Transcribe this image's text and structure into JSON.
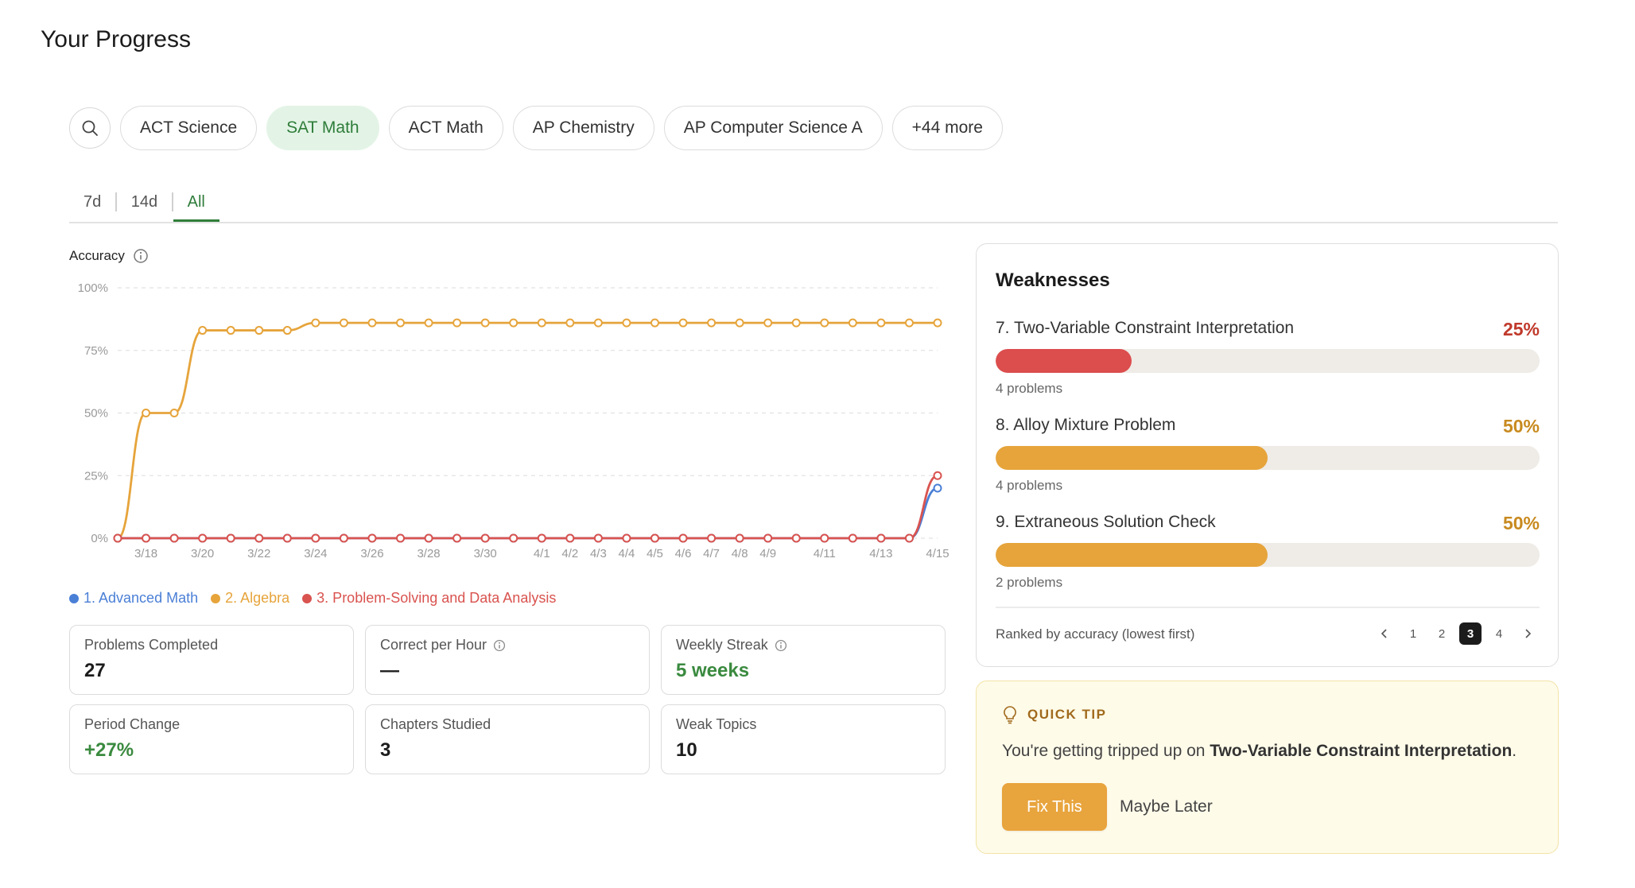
{
  "page": {
    "title": "Your Progress"
  },
  "subjects": {
    "items": [
      {
        "label": "ACT Science",
        "active": false
      },
      {
        "label": "SAT Math",
        "active": true
      },
      {
        "label": "ACT Math",
        "active": false
      },
      {
        "label": "AP Chemistry",
        "active": false
      },
      {
        "label": "AP Computer Science A",
        "active": false
      },
      {
        "label": "+44 more",
        "active": false
      }
    ]
  },
  "range_tabs": [
    {
      "label": "7d",
      "active": false
    },
    {
      "label": "14d",
      "active": false
    },
    {
      "label": "All",
      "active": true
    }
  ],
  "accuracy": {
    "label": "Accuracy"
  },
  "chart_data": {
    "type": "line",
    "ylabel": "Accuracy",
    "ylim": [
      0,
      100
    ],
    "y_ticks": [
      "0%",
      "25%",
      "50%",
      "75%",
      "100%"
    ],
    "grid": true,
    "x": [
      "3/17",
      "3/18",
      "3/19",
      "3/20",
      "3/21",
      "3/22",
      "3/23",
      "3/24",
      "3/25",
      "3/26",
      "3/27",
      "3/28",
      "3/29",
      "3/30",
      "3/31",
      "4/1",
      "4/2",
      "4/3",
      "4/4",
      "4/5",
      "4/6",
      "4/7",
      "4/8",
      "4/9",
      "4/10",
      "4/11",
      "4/12",
      "4/13",
      "4/14",
      "4/15"
    ],
    "x_tick_labels": [
      "3/18",
      "3/20",
      "3/22",
      "3/24",
      "3/26",
      "3/28",
      "3/30",
      "4/1",
      "4/2",
      "4/3",
      "4/4",
      "4/5",
      "4/6",
      "4/7",
      "4/8",
      "4/9",
      "4/11",
      "4/13",
      "4/15"
    ],
    "series": [
      {
        "name": "1. Advanced Math",
        "color": "#4a7fd6",
        "values": [
          0,
          0,
          0,
          0,
          0,
          0,
          0,
          0,
          0,
          0,
          0,
          0,
          0,
          0,
          0,
          0,
          0,
          0,
          0,
          0,
          0,
          0,
          0,
          0,
          0,
          0,
          0,
          0,
          0,
          20
        ]
      },
      {
        "name": "2. Algebra",
        "color": "#e6a43b",
        "values": [
          0,
          50,
          50,
          83,
          83,
          83,
          83,
          86,
          86,
          86,
          86,
          86,
          86,
          86,
          86,
          86,
          86,
          86,
          86,
          86,
          86,
          86,
          86,
          86,
          86,
          86,
          86,
          86,
          86,
          86
        ]
      },
      {
        "name": "3. Problem-Solving and Data Analysis",
        "color": "#d9534f",
        "values": [
          0,
          0,
          0,
          0,
          0,
          0,
          0,
          0,
          0,
          0,
          0,
          0,
          0,
          0,
          0,
          0,
          0,
          0,
          0,
          0,
          0,
          0,
          0,
          0,
          0,
          0,
          0,
          0,
          0,
          25
        ]
      }
    ],
    "legend_position": "bottom-left"
  },
  "stats": [
    {
      "label": "Problems Completed",
      "value": "27",
      "info": false,
      "accent": false
    },
    {
      "label": "Correct per Hour",
      "value": "—",
      "info": true,
      "accent": false
    },
    {
      "label": "Weekly Streak",
      "value": "5 weeks",
      "info": true,
      "accent": true
    },
    {
      "label": "Period Change",
      "value": "+27%",
      "info": false,
      "accent": true
    },
    {
      "label": "Chapters Studied",
      "value": "3",
      "info": false,
      "accent": false
    },
    {
      "label": "Weak Topics",
      "value": "10",
      "info": false,
      "accent": false
    }
  ],
  "weaknesses": {
    "title": "Weaknesses",
    "items": [
      {
        "name": "7. Two-Variable Constraint Interpretation",
        "pct_label": "25%",
        "pct": 25,
        "count": "4 problems",
        "color": "#dc4d4d",
        "pct_color": "#c0392b"
      },
      {
        "name": "8. Alloy Mixture Problem",
        "pct_label": "50%",
        "pct": 50,
        "count": "4 problems",
        "color": "#e6a43b",
        "pct_color": "#c88a1f"
      },
      {
        "name": "9. Extraneous Solution Check",
        "pct_label": "50%",
        "pct": 50,
        "count": "2 problems",
        "color": "#e6a43b",
        "pct_color": "#c88a1f"
      }
    ],
    "footer": "Ranked by accuracy (lowest first)",
    "pages": [
      "1",
      "2",
      "3",
      "4"
    ],
    "current_page": "3"
  },
  "tip": {
    "heading": "QUICK TIP",
    "text_prefix": "You're getting tripped up on ",
    "text_bold": "Two-Variable Constraint Interpretation",
    "text_suffix": ".",
    "primary_label": "Fix This",
    "secondary_label": "Maybe Later"
  }
}
